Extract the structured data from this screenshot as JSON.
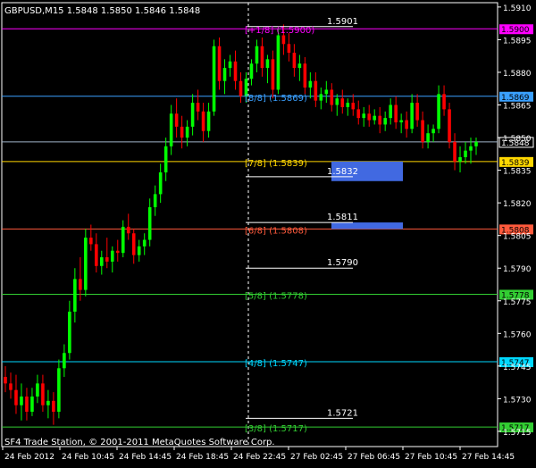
{
  "chart_data": {
    "type": "candlestick",
    "symbol_line": "GBPUSD,M15  1.5848 1.5850 1.5846 1.5848",
    "footer": "SF4 Trade Station, © 2001-2011 MetaQuotes Software Corp.",
    "ylim": [
      1.5708,
      1.5912
    ],
    "price_ticks": [
      "1.5910",
      "1.5895",
      "1.5880",
      "1.5865",
      "1.5850",
      "1.5835",
      "1.5820",
      "1.5805",
      "1.5790",
      "1.5775",
      "1.5760",
      "1.5745",
      "1.5730",
      "1.5715"
    ],
    "time_labels": [
      "24 Feb 2012",
      "24 Feb 10:45",
      "24 Feb 14:45",
      "24 Feb 18:45",
      "24 Feb 22:45",
      "27 Feb 02:45",
      "27 Feb 06:45",
      "27 Feb 10:45",
      "27 Feb 14:45"
    ],
    "murrey_levels": [
      {
        "label": "[+1/8]  (1.5900)",
        "price": 1.59,
        "color": "#ff00ff",
        "tag": "1.5900"
      },
      {
        "label": "[8/8]  (1.5869)",
        "price": 1.5869,
        "color": "#3aa0ff",
        "tag": "1.5869"
      },
      {
        "label": "[7/8]  (1.5839)",
        "price": 1.5839,
        "color": "#ffd700",
        "tag": "1.5839"
      },
      {
        "label": "[6/8]  (1.5808)",
        "price": 1.5808,
        "color": "#ff5a3c",
        "tag": "1.5808"
      },
      {
        "label": "[5/8]  (1.5778)",
        "price": 1.5778,
        "color": "#32cd32",
        "tag": "1.5778"
      },
      {
        "label": "[4/8]  (1.5747)",
        "price": 1.5747,
        "color": "#00d8ff",
        "tag": "1.5747"
      },
      {
        "label": "[3/8]  (1.5717)",
        "price": 1.5717,
        "color": "#32cd32",
        "tag": "1.5717"
      }
    ],
    "current_price": {
      "price": 1.5848,
      "tag": "1.5848"
    },
    "white_levels": [
      {
        "label": "1.5901",
        "price": 1.5901
      },
      {
        "label": "1.5832",
        "price": 1.5832
      },
      {
        "label": "1.5811",
        "price": 1.5811
      },
      {
        "label": "1.5790",
        "price": 1.579
      },
      {
        "label": "1.5721",
        "price": 1.5721
      }
    ],
    "zones": [
      {
        "top": 1.5839,
        "bottom": 1.583
      },
      {
        "top": 1.5811,
        "bottom": 1.5808
      }
    ],
    "candles": [
      [
        1.574,
        1.5745,
        1.5733,
        1.5737
      ],
      [
        1.5737,
        1.5742,
        1.573,
        1.5734
      ],
      [
        1.5734,
        1.5741,
        1.5723,
        1.5727
      ],
      [
        1.5727,
        1.5737,
        1.572,
        1.5731
      ],
      [
        1.5731,
        1.5735,
        1.572,
        1.5724
      ],
      [
        1.5724,
        1.5735,
        1.5722,
        1.5731
      ],
      [
        1.5731,
        1.5741,
        1.5728,
        1.5737
      ],
      [
        1.5737,
        1.5741,
        1.5724,
        1.5727
      ],
      [
        1.5727,
        1.5734,
        1.5721,
        1.5729
      ],
      [
        1.5729,
        1.5733,
        1.5718,
        1.5724
      ],
      [
        1.5724,
        1.5748,
        1.5721,
        1.5744
      ],
      [
        1.5744,
        1.5755,
        1.574,
        1.5751
      ],
      [
        1.5751,
        1.5775,
        1.5748,
        1.577
      ],
      [
        1.577,
        1.579,
        1.5765,
        1.5785
      ],
      [
        1.5785,
        1.5795,
        1.5775,
        1.578
      ],
      [
        1.578,
        1.5808,
        1.5777,
        1.5804
      ],
      [
        1.5804,
        1.581,
        1.5798,
        1.5801
      ],
      [
        1.5801,
        1.5806,
        1.5788,
        1.5791
      ],
      [
        1.5791,
        1.5798,
        1.5787,
        1.5795
      ],
      [
        1.5795,
        1.5804,
        1.579,
        1.5793
      ],
      [
        1.5793,
        1.58,
        1.5788,
        1.5798
      ],
      [
        1.5798,
        1.5803,
        1.5793,
        1.5797
      ],
      [
        1.5797,
        1.5812,
        1.5795,
        1.5809
      ],
      [
        1.5809,
        1.5815,
        1.5803,
        1.5806
      ],
      [
        1.5806,
        1.5808,
        1.5792,
        1.5796
      ],
      [
        1.5796,
        1.5803,
        1.5793,
        1.58
      ],
      [
        1.58,
        1.5806,
        1.5796,
        1.5803
      ],
      [
        1.5803,
        1.5822,
        1.58,
        1.5818
      ],
      [
        1.5818,
        1.5828,
        1.5814,
        1.5824
      ],
      [
        1.5824,
        1.5838,
        1.582,
        1.5834
      ],
      [
        1.5834,
        1.585,
        1.583,
        1.5846
      ],
      [
        1.5846,
        1.5865,
        1.5842,
        1.5861
      ],
      [
        1.5861,
        1.5868,
        1.585,
        1.5855
      ],
      [
        1.5855,
        1.586,
        1.5845,
        1.585
      ],
      [
        1.585,
        1.5858,
        1.5846,
        1.5855
      ],
      [
        1.5855,
        1.587,
        1.5851,
        1.5866
      ],
      [
        1.5866,
        1.5872,
        1.5858,
        1.5862
      ],
      [
        1.5862,
        1.5866,
        1.5848,
        1.5853
      ],
      [
        1.5853,
        1.5866,
        1.585,
        1.5862
      ],
      [
        1.5862,
        1.5895,
        1.586,
        1.5892
      ],
      [
        1.5892,
        1.5896,
        1.5872,
        1.5876
      ],
      [
        1.5876,
        1.5886,
        1.587,
        1.5882
      ],
      [
        1.5882,
        1.5888,
        1.5878,
        1.5885
      ],
      [
        1.5885,
        1.589,
        1.5872,
        1.5876
      ],
      [
        1.5876,
        1.588,
        1.5866,
        1.5869
      ],
      [
        1.5869,
        1.588,
        1.5866,
        1.5877
      ],
      [
        1.5877,
        1.5886,
        1.5874,
        1.5884
      ],
      [
        1.5884,
        1.5895,
        1.588,
        1.5892
      ],
      [
        1.5892,
        1.5896,
        1.5878,
        1.5882
      ],
      [
        1.5882,
        1.5888,
        1.5875,
        1.5886
      ],
      [
        1.5886,
        1.589,
        1.5868,
        1.5872
      ],
      [
        1.5872,
        1.59,
        1.587,
        1.5897
      ],
      [
        1.5897,
        1.5902,
        1.5888,
        1.5893
      ],
      [
        1.5893,
        1.5898,
        1.5885,
        1.5889
      ],
      [
        1.5889,
        1.5893,
        1.5878,
        1.5882
      ],
      [
        1.5882,
        1.5888,
        1.5876,
        1.5884
      ],
      [
        1.5884,
        1.5887,
        1.587,
        1.5873
      ],
      [
        1.5873,
        1.588,
        1.5868,
        1.5876
      ],
      [
        1.5876,
        1.588,
        1.5864,
        1.5867
      ],
      [
        1.5867,
        1.5873,
        1.5863,
        1.587
      ],
      [
        1.587,
        1.5876,
        1.5866,
        1.5872
      ],
      [
        1.5872,
        1.5875,
        1.5862,
        1.5865
      ],
      [
        1.5865,
        1.587,
        1.586,
        1.5868
      ],
      [
        1.5868,
        1.5872,
        1.5861,
        1.5864
      ],
      [
        1.5864,
        1.5868,
        1.586,
        1.5866
      ],
      [
        1.5866,
        1.587,
        1.586,
        1.5863
      ],
      [
        1.5863,
        1.5867,
        1.5856,
        1.5859
      ],
      [
        1.5859,
        1.5864,
        1.5855,
        1.5861
      ],
      [
        1.5861,
        1.5865,
        1.5855,
        1.5858
      ],
      [
        1.5858,
        1.5863,
        1.5856,
        1.586
      ],
      [
        1.586,
        1.5864,
        1.5852,
        1.5856
      ],
      [
        1.5856,
        1.5862,
        1.5853,
        1.5859
      ],
      [
        1.5859,
        1.5868,
        1.5856,
        1.5865
      ],
      [
        1.5865,
        1.5869,
        1.5854,
        1.5857
      ],
      [
        1.5857,
        1.5861,
        1.5852,
        1.5858
      ],
      [
        1.5858,
        1.5862,
        1.585,
        1.5854
      ],
      [
        1.5854,
        1.587,
        1.5852,
        1.5866
      ],
      [
        1.5866,
        1.587,
        1.5855,
        1.5858
      ],
      [
        1.5858,
        1.5862,
        1.5845,
        1.5848
      ],
      [
        1.5848,
        1.5856,
        1.5845,
        1.5852
      ],
      [
        1.5852,
        1.5856,
        1.5848,
        1.5854
      ],
      [
        1.5854,
        1.5874,
        1.5852,
        1.587
      ],
      [
        1.587,
        1.5874,
        1.586,
        1.5863
      ],
      [
        1.5863,
        1.5866,
        1.5845,
        1.5848
      ],
      [
        1.5848,
        1.5852,
        1.5835,
        1.5839
      ],
      [
        1.5839,
        1.5846,
        1.5834,
        1.5841
      ],
      [
        1.5841,
        1.5848,
        1.5838,
        1.5844
      ],
      [
        1.5844,
        1.585,
        1.5838,
        1.5846
      ],
      [
        1.5846,
        1.585,
        1.5842,
        1.5848
      ]
    ]
  }
}
